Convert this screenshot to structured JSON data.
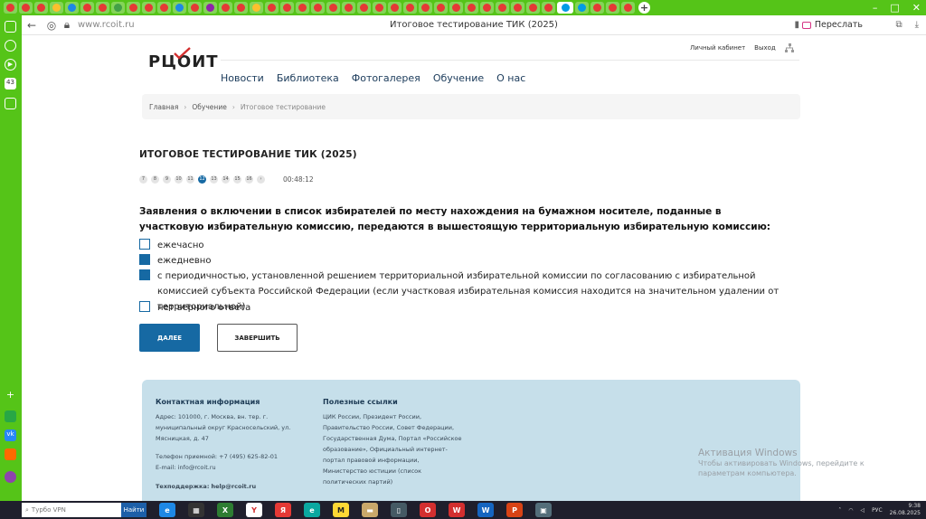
{
  "browser": {
    "url": "www.rcoit.ru",
    "tab_title": "Итоговое тестирование ТИК (2025)",
    "resend_label": "Переслать",
    "left_badge": "43",
    "tab_colors": [
      "#e53935",
      "#e53935",
      "#e53935",
      "#fbc02d",
      "#1e88e5",
      "#e53935",
      "#e53935",
      "#43a047",
      "#e53935",
      "#e53935",
      "#e53935",
      "#1e88e5",
      "#e53935",
      "#8e24aa",
      "#e53935",
      "#e53935",
      "#fbc02d",
      "#e53935",
      "#e53935",
      "#e53935",
      "#e53935",
      "#e53935",
      "#e53935",
      "#e53935",
      "#e53935",
      "#e53935",
      "#e53935",
      "#e53935",
      "#e53935",
      "#e53935",
      "#e53935",
      "#e53935",
      "#e53935",
      "#e53935",
      "#e53935",
      "#e53935",
      "#039be5",
      "#039be5",
      "#e53935",
      "#e53935",
      "#e53935"
    ]
  },
  "site": {
    "logo": "РЦОИТ",
    "nav": [
      "Новости",
      "Библиотека",
      "Фотогалерея",
      "Обучение",
      "О нас"
    ],
    "personal_cabinet": "Личный кабинет",
    "logout": "Выход",
    "breadcrumb": [
      "Главная",
      "Обучение",
      "Итоговое тестирование"
    ]
  },
  "test": {
    "title": "ИТОГОВОЕ ТЕСТИРОВАНИЕ ТИК (2025)",
    "pages": [
      "7",
      "8",
      "9",
      "10",
      "11",
      "12",
      "13",
      "14",
      "15",
      "16",
      "›"
    ],
    "active_page": "12",
    "timer": "00:48:12",
    "question": "Заявления о включении в список избирателей по месту нахождения на бумажном носителе, поданные в участковую избирательную комиссию, передаются в вышестоящую территориальную избирательную комиссию:",
    "options": [
      {
        "text": "ежечасно",
        "checked": false
      },
      {
        "text": "ежедневно",
        "checked": true
      },
      {
        "text": "с периодичностью, установленной решением территориальной избирательной комиссии по согласованию с избирательной комиссией субъекта Российской Федерации (если участковая избирательная комиссия находится на значительном удалении от территориальной)",
        "checked": true
      },
      {
        "text": "нет верного ответа",
        "checked": false
      }
    ],
    "next_label": "ДАЛЕЕ",
    "finish_label": "ЗАВЕРШИТЬ"
  },
  "footer": {
    "contact_title": "Контактная информация",
    "address": "Адрес: 101000, г. Москва, вн. тер. г. муниципальный округ Красносельский, ул. Мясницкая, д. 47",
    "phone": "Телефон приемной: +7 (495) 625-82-01",
    "email": "E-mail: info@rcoit.ru",
    "support_label": "Техподдержка:",
    "support_email": "help@rcoit.ru",
    "links_title": "Полезные ссылки",
    "links": "ЦИК России, Президент России, Правительство России, Совет Федерации, Государственная Дума, Портал «Российское образование», Официальный интернет-портал правовой информации, Министерство юстиции (список политических партий)"
  },
  "watermark": {
    "title": "Активация Windows",
    "subtitle": "Чтобы активировать Windows, перейдите к параметрам компьютера."
  },
  "taskbar": {
    "search_placeholder": "Турбо VPN",
    "search_button": "Найти",
    "time": "9:38",
    "date": "26.08.2025",
    "lang": "РУС"
  }
}
